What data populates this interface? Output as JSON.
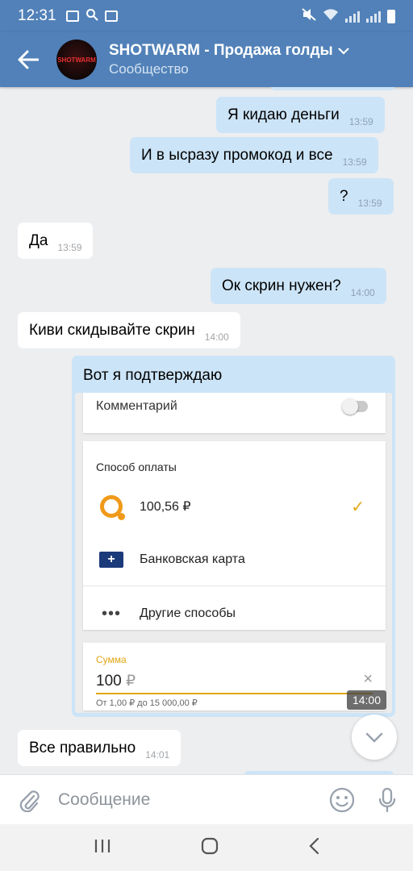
{
  "status_bar": {
    "time": "12:31"
  },
  "header": {
    "title": "SHOTWARM - Продажа голды",
    "subtitle": "Сообщество",
    "avatar_text": "SHOTWARM"
  },
  "messages": [
    {
      "dir": "out",
      "text": "Я кидаю деньги",
      "time": "13:59"
    },
    {
      "dir": "out",
      "text": "И в ысразу промокод и все",
      "time": "13:59"
    },
    {
      "dir": "out",
      "text": "?",
      "time": "13:59"
    },
    {
      "dir": "in",
      "text": "Да",
      "time": "13:59"
    },
    {
      "dir": "out",
      "text": "Ок скрин нужен?",
      "time": "14:00"
    },
    {
      "dir": "in",
      "text": "Киви скидывайте скрин",
      "time": "14:00"
    },
    {
      "dir": "in",
      "text": "Все правильно",
      "time": "14:01"
    }
  ],
  "photo_message": {
    "caption": "Вот я подтверждаю",
    "time": "14:00",
    "screenshot": {
      "comment_label": "Комментарий",
      "payment_method_label": "Способ оплаты",
      "options": [
        {
          "icon": "qiwi-icon",
          "label": "100,56 ₽",
          "selected": true
        },
        {
          "icon": "bank-card-icon",
          "label": "Банковская карта",
          "selected": false
        },
        {
          "icon": "more-dots-icon",
          "label": "Другие способы",
          "selected": false
        }
      ],
      "amount_label": "Сумма",
      "amount_value": "100",
      "amount_currency": "₽",
      "amount_hint": "От 1,00 ₽ до 15 000,00 ₽",
      "accent_color": "#e0a514"
    }
  },
  "composer": {
    "placeholder": "Сообщение"
  },
  "colors": {
    "header_bg": "#5181b8",
    "outgoing_bubble": "#cce4f7",
    "incoming_bubble": "#ffffff",
    "chat_bg": "#edeef0"
  }
}
